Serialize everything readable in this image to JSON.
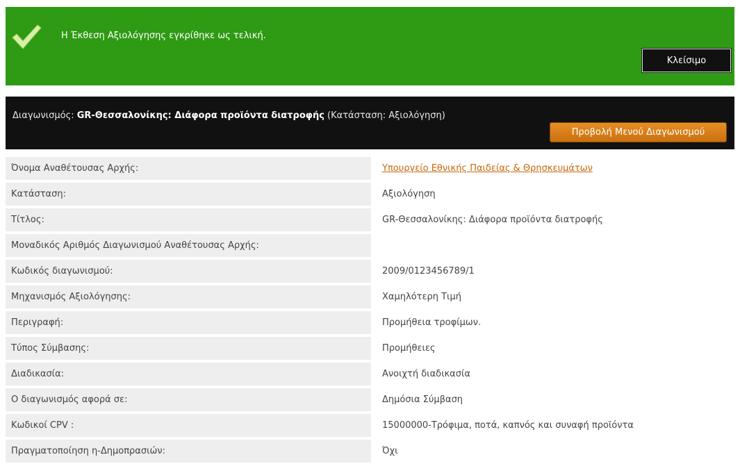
{
  "banner": {
    "message": "Η Έκθεση Αξιολόγησης εγκρίθηκε ως τελική.",
    "close_label": "Κλείσιμο",
    "icon": "checkmark-icon",
    "color": "#2f9a14"
  },
  "tender": {
    "prefix": "Διαγωνισμός: ",
    "name": "GR-Θεσσαλονίκης: Διάφορα προϊόντα διατροφής",
    "status": " (Κατάσταση: Αξιολόγηση)",
    "menu_button": "Προβολή Μενού Διαγωνισμού"
  },
  "details": [
    {
      "label": "Όνομα Αναθέτουσας Αρχής:",
      "value": "Υπουργείο Εθνικής Παιδείας & Θρησκευμάτων",
      "link": true
    },
    {
      "label": "Κατάσταση:",
      "value": "Αξιολόγηση"
    },
    {
      "label": "Τίτλος:",
      "value": "GR-Θεσσαλονίκης: Διάφορα προϊόντα διατροφής"
    },
    {
      "label": "Μοναδικός Αριθμός Διαγωνισμού Αναθέτουσας Αρχής:",
      "value": ""
    },
    {
      "label": "Κωδικός διαγωνισμού:",
      "value": "2009/0123456789/1"
    },
    {
      "label": "Μηχανισμός Αξιολόγησης:",
      "value": "Χαμηλότερη Τιμή"
    },
    {
      "label": "Περιγραφή:",
      "value": "Προμήθεια τροφίμων."
    },
    {
      "label": "Τύπος Σύμβασης:",
      "value": "Προμήθειες"
    },
    {
      "label": "Διαδικασία:",
      "value": "Ανοιχτή διαδικασία"
    },
    {
      "label": "Ο διαγωνισμός αφορά σε:",
      "value": "Δημόσια Σύμβαση"
    },
    {
      "label": "Κωδικοί CPV :",
      "value": "15000000-Τρόφιμα, ποτά, καπνός και συναφή προϊόντα"
    },
    {
      "label": "Πραγματοποίηση η-Δημοπρασιών:",
      "value": "Όχι"
    }
  ]
}
